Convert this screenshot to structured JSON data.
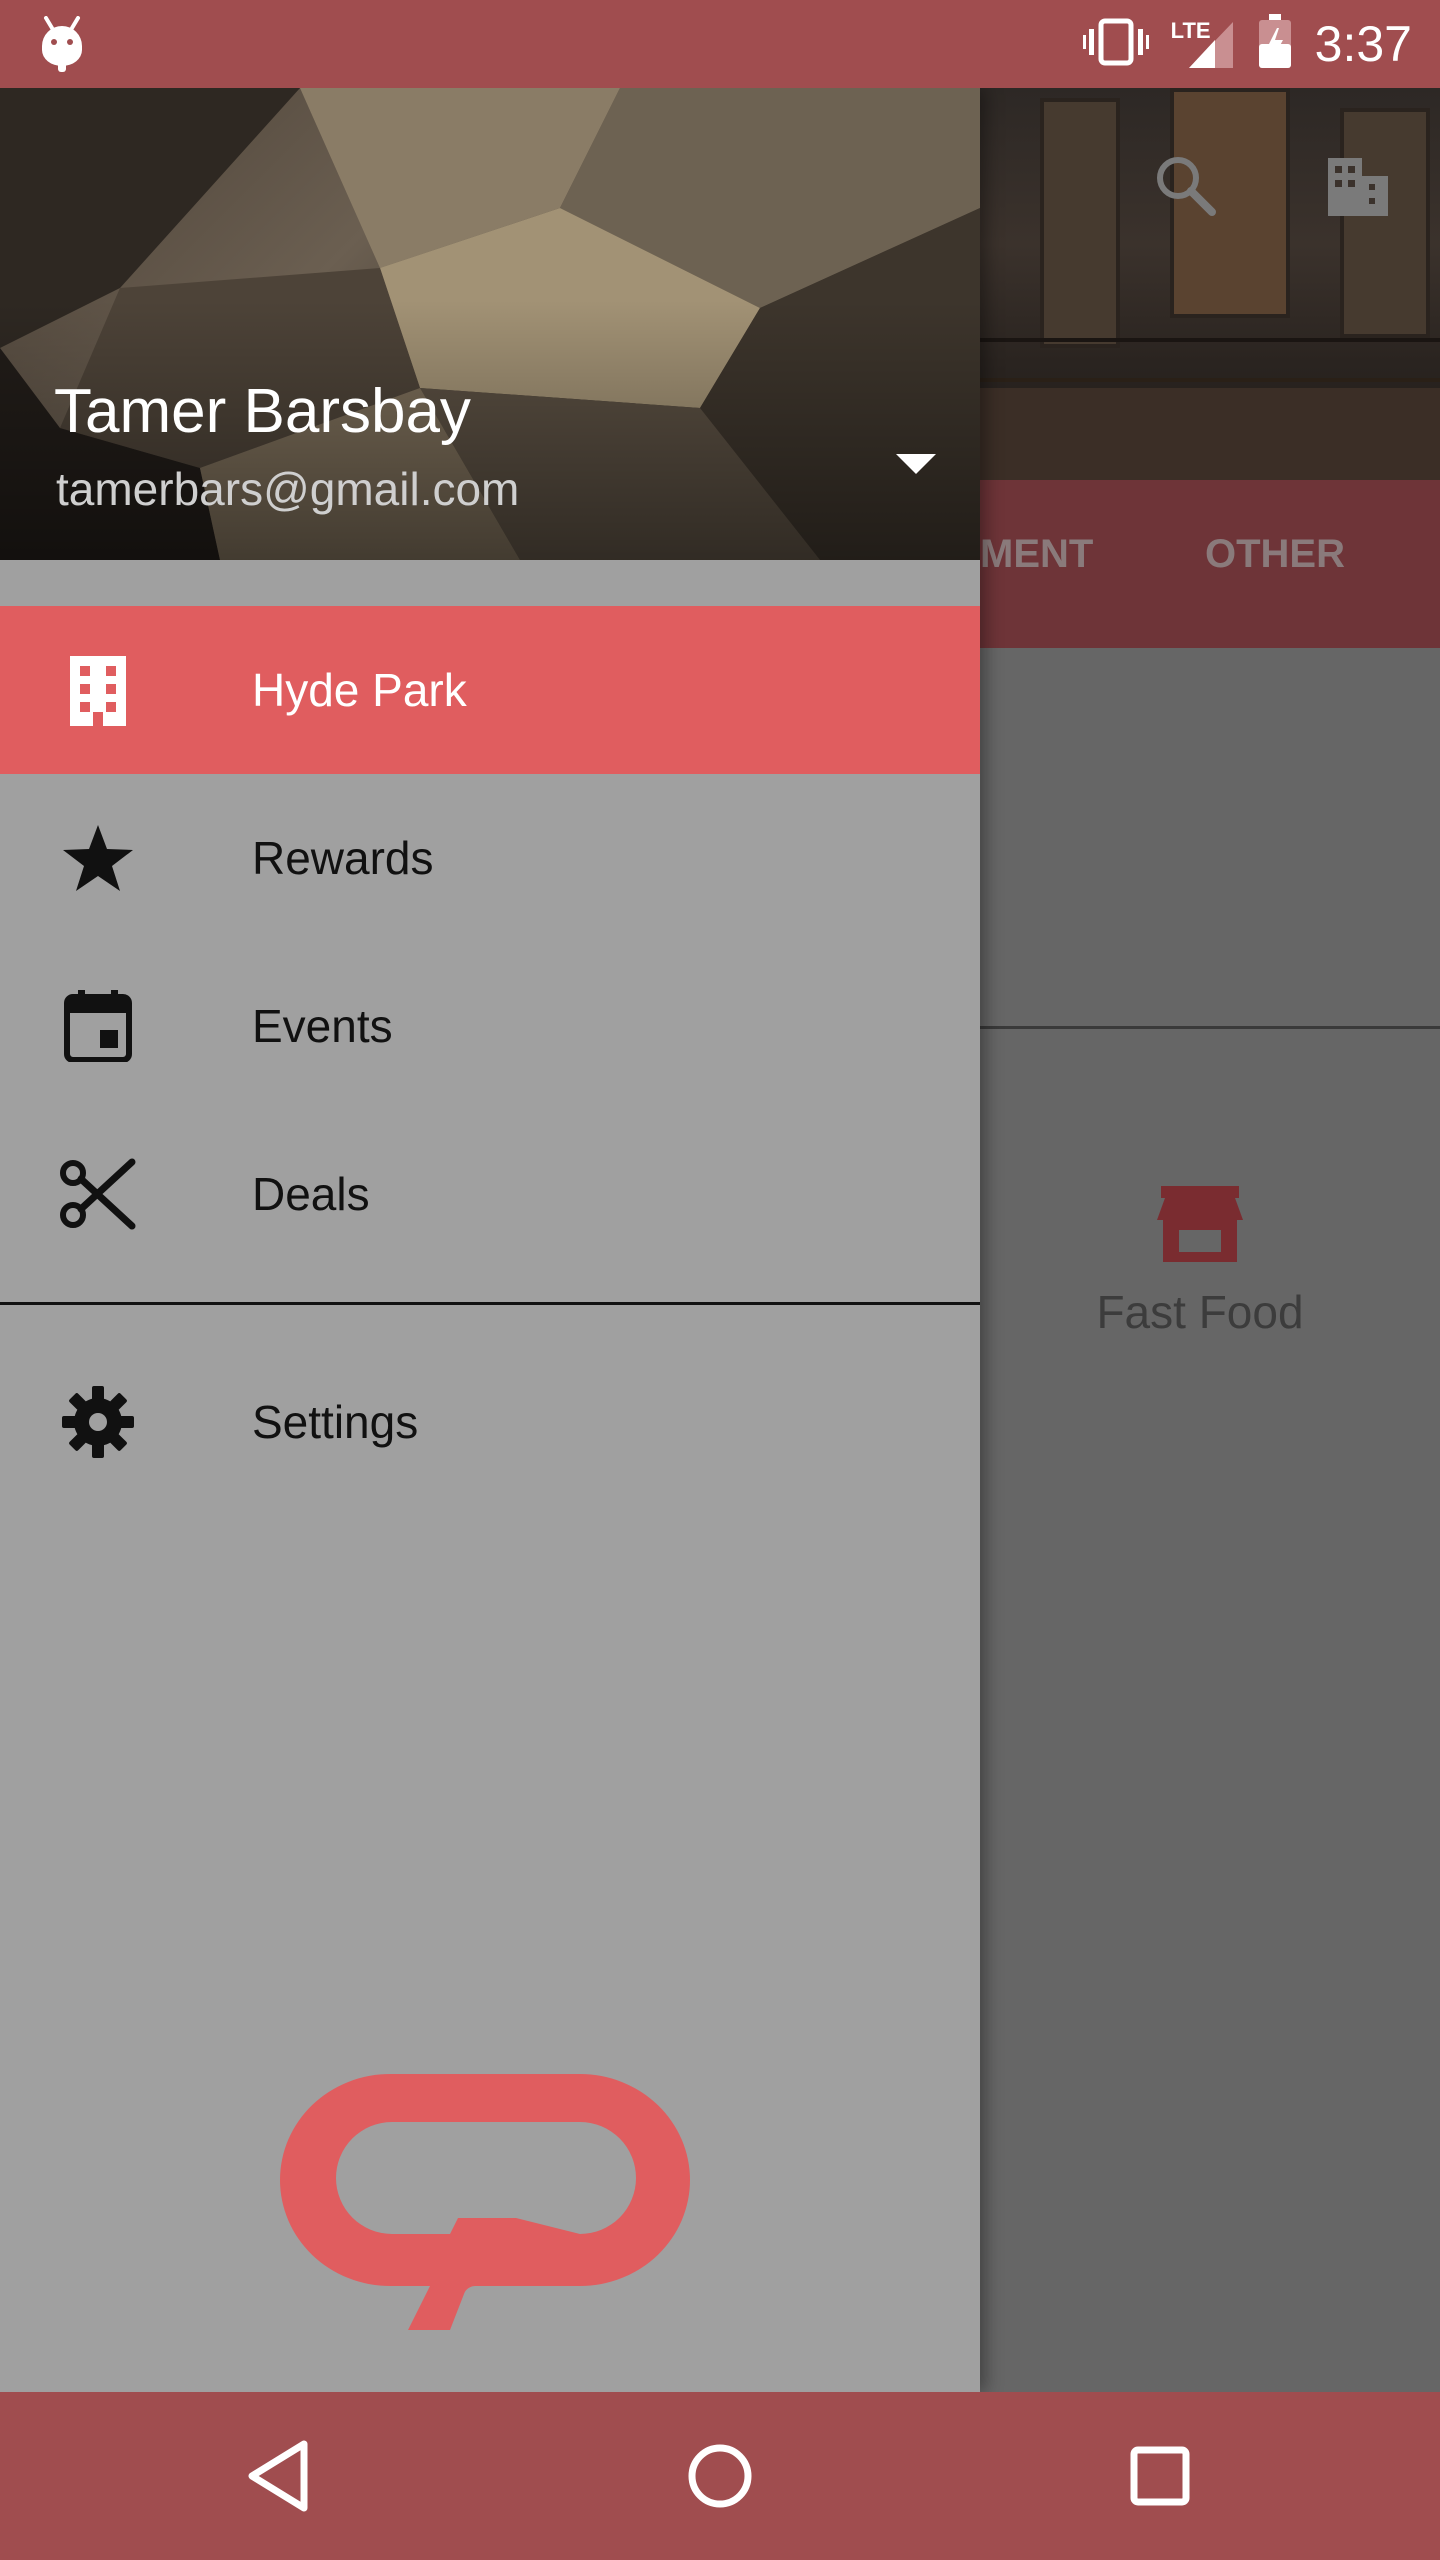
{
  "status_bar": {
    "time": "3:37",
    "network_label": "LTE",
    "icons": [
      "android-debug-icon",
      "vibrate-icon",
      "signal-icon",
      "battery-charging-icon"
    ]
  },
  "background_page": {
    "tabs": [
      "MENT",
      "OTHER"
    ],
    "category": {
      "label": "Fast Food",
      "icon": "store-icon"
    },
    "toolbar_icons": [
      "search-icon",
      "building-icon"
    ]
  },
  "drawer": {
    "account": {
      "name": "Tamer Barsbay",
      "email": "tamerbars@gmail.com"
    },
    "items": [
      {
        "label": "Hyde Park",
        "icon": "building-icon",
        "active": true
      },
      {
        "label": "Rewards",
        "icon": "star-icon",
        "active": false
      },
      {
        "label": "Events",
        "icon": "calendar-icon",
        "active": false
      },
      {
        "label": "Deals",
        "icon": "scissors-icon",
        "active": false
      }
    ],
    "settings": {
      "label": "Settings",
      "icon": "gear-icon"
    },
    "logo": "brand-logo"
  },
  "nav_bar": {
    "buttons": [
      "back-button",
      "home-button",
      "recents-button"
    ]
  },
  "colors": {
    "accent": "#e05d5f",
    "bar": "#a04d4f",
    "drawer_bg": "#a0a0a0",
    "scrim_bg": "#666666"
  }
}
